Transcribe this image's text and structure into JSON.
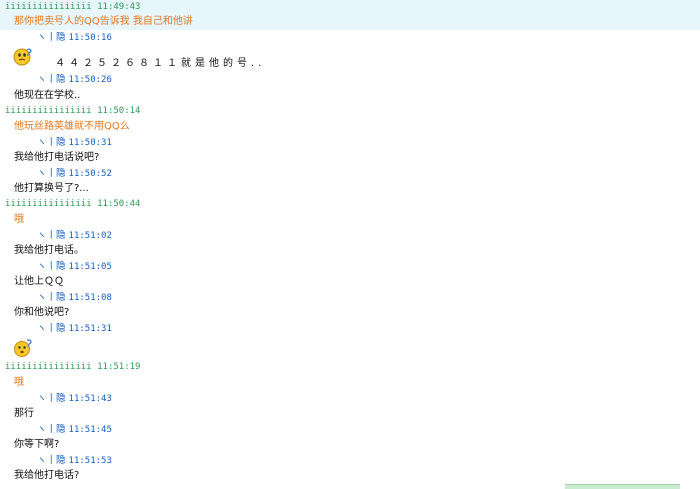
{
  "chat": {
    "sender_a": "iiiiiiiiiiiiiiii",
    "sender_b": "ヽ丨隐",
    "messages": [
      {
        "from": "a",
        "time": "11:49:43",
        "text": "那你把卖号人的QQ告诉我    我自己和他讲"
      },
      {
        "from": "b",
        "time": "11:50:16",
        "text": "",
        "icon": "confused-emoticon-icon"
      },
      {
        "from": "b",
        "time": "",
        "text": "４４２５２６８１１就是他的号.."
      },
      {
        "from": "b",
        "time": "11:50:26",
        "text": "他现在在学校.."
      },
      {
        "from": "a",
        "time": "11:50:14",
        "text": "他玩丝路英雄就不用QQ么"
      },
      {
        "from": "b",
        "time": "11:50:31",
        "text": "我给他打电话说吧?"
      },
      {
        "from": "b",
        "time": "11:50:52",
        "text": "他打算换号了?..."
      },
      {
        "from": "a",
        "time": "11:50:44",
        "text": "哦"
      },
      {
        "from": "b",
        "time": "11:51:02",
        "text": "我给他打电话。"
      },
      {
        "from": "b",
        "time": "11:51:05",
        "text": "让他上ＱＱ"
      },
      {
        "from": "b",
        "time": "11:51:08",
        "text": "你和他说吧?"
      },
      {
        "from": "b",
        "time": "11:51:31",
        "text": "",
        "icon": "thinking-emoticon-icon"
      },
      {
        "from": "a",
        "time": "11:51:19",
        "text": "哦"
      },
      {
        "from": "b",
        "time": "11:51:43",
        "text": "那行"
      },
      {
        "from": "b",
        "time": "11:51:45",
        "text": "你等下啊?"
      },
      {
        "from": "b",
        "time": "11:51:53",
        "text": "我给他打电话?"
      }
    ]
  },
  "colors": {
    "sender_a_header": "#2f9a57",
    "sender_b_header": "#1560c8",
    "sender_a_text": "#e8781c",
    "sender_b_text": "#111111",
    "highlight_strip": "#e6f6fb"
  }
}
